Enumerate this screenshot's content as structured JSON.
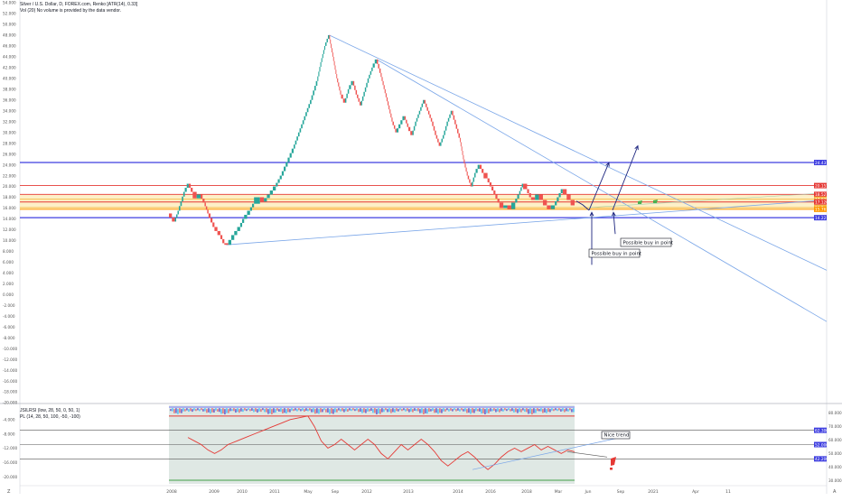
{
  "header": {
    "title": "Silver / U.S. Dollar, D, FOREX.com, Renko [ATR(14), 0.33]",
    "subtitle": "Vol (20) No volume is provided by the data vendor.",
    "osc_legend_1": "JSILRSI (low, 28, 50, 0, 50, 1)",
    "osc_legend_2": "PL (14, 28, 50, 100, -50, -100)"
  },
  "annotations": {
    "buy_1": "Possible buy in point",
    "buy_2": "Possible buy in point",
    "nice_trend": "Nice trend"
  },
  "colors": {
    "up": "#26a69a",
    "down": "#ef5350",
    "trendline": "#7aa6e8",
    "support_blue": "#3f3fe0",
    "resistance_red": "#e53935",
    "zone_fill": "#fdf0c8",
    "osc_bg": "#dfe8e4",
    "osc_line": "#e53935"
  },
  "price_labels": [
    {
      "text": "24.43",
      "color": "#3f3fe0"
    },
    {
      "text": "20.157",
      "color": "#e53935"
    },
    {
      "text": "18.527",
      "color": "#e53935"
    },
    {
      "text": "17.632",
      "color": "#f5b942"
    },
    {
      "text": "17.126",
      "color": "#e53935"
    },
    {
      "text": "16.1",
      "color": "#f5b942"
    },
    {
      "text": "15.767",
      "color": "#ff9800"
    },
    {
      "text": "14.22",
      "color": "#3f3fe0"
    }
  ],
  "osc_right_labels": [
    {
      "text": "62.300",
      "color": "#3f3fe0"
    },
    {
      "text": "52.000",
      "color": "#3f3fe0"
    },
    {
      "text": "42.200",
      "color": "#3f3fe0"
    }
  ],
  "chart_data": [
    {
      "type": "line",
      "title": "Silver / U.S. Dollar, D, FOREX.com, Renko [ATR(14), 0.33]",
      "x_ticks": [
        "2008",
        "2009",
        "2010",
        "2011",
        "May",
        "Sep",
        "2012",
        "2013",
        "2014",
        "2016",
        "2018",
        "Mar",
        "Jun",
        "Sep",
        "2021",
        "Apr",
        "11"
      ],
      "y_ticks": [
        "54.000",
        "52.000",
        "50.000",
        "48.000",
        "46.000",
        "44.000",
        "42.000",
        "40.000",
        "38.000",
        "36.000",
        "34.000",
        "32.000",
        "30.000",
        "28.000",
        "26.000",
        "24.000",
        "22.000",
        "20.000",
        "18.000",
        "16.000",
        "14.000",
        "12.000",
        "10.000",
        "8.000",
        "6.000",
        "4.000",
        "2.000",
        "0.000",
        "-2.000",
        "-4.000",
        "-6.000",
        "-8.000",
        "-10.000",
        "-12.000",
        "-14.000",
        "-16.000",
        "-18.000",
        "-20.000"
      ],
      "ylim": [
        -20,
        54
      ],
      "series": [
        {
          "name": "Silver / U.S. Dollar",
          "points": [
            [
              0,
              15
            ],
            [
              3,
              13.5
            ],
            [
              5,
              15.5
            ],
            [
              8,
              19
            ],
            [
              10,
              20.5
            ],
            [
              12,
              19
            ],
            [
              14,
              17.8
            ],
            [
              16,
              18.5
            ],
            [
              18,
              17
            ],
            [
              20,
              15
            ],
            [
              23,
              12.5
            ],
            [
              26,
              11
            ],
            [
              28,
              9.5
            ],
            [
              30,
              9.2
            ],
            [
              33,
              11
            ],
            [
              36,
              12.5
            ],
            [
              38,
              14
            ],
            [
              41,
              15.5
            ],
            [
              43,
              16.8
            ],
            [
              46,
              18
            ],
            [
              48,
              17.2
            ],
            [
              51,
              18.5
            ],
            [
              54,
              20
            ],
            [
              57,
              22
            ],
            [
              60,
              24.5
            ],
            [
              63,
              27
            ],
            [
              66,
              30
            ],
            [
              69,
              33
            ],
            [
              72,
              36
            ],
            [
              75,
              39.5
            ],
            [
              77,
              43
            ],
            [
              79,
              46
            ],
            [
              81,
              48
            ],
            [
              83,
              44
            ],
            [
              85,
              40
            ],
            [
              87,
              37
            ],
            [
              89,
              35.5
            ],
            [
              91,
              38
            ],
            [
              93,
              39.5
            ],
            [
              95,
              37
            ],
            [
              97,
              35
            ],
            [
              99,
              37.5
            ],
            [
              101,
              40
            ],
            [
              103,
              42
            ],
            [
              105,
              43.5
            ],
            [
              107,
              41
            ],
            [
              109,
              38
            ],
            [
              111,
              35
            ],
            [
              113,
              32
            ],
            [
              115,
              30
            ],
            [
              117,
              31.5
            ],
            [
              119,
              33
            ],
            [
              121,
              31
            ],
            [
              123,
              29.5
            ],
            [
              125,
              32
            ],
            [
              127,
              34
            ],
            [
              129,
              36
            ],
            [
              131,
              34
            ],
            [
              133,
              32
            ],
            [
              135,
              29.5
            ],
            [
              137,
              27.5
            ],
            [
              139,
              29.5
            ],
            [
              141,
              32
            ],
            [
              143,
              34
            ],
            [
              145,
              31.5
            ],
            [
              147,
              29
            ],
            [
              149,
              25
            ],
            [
              151,
              22
            ],
            [
              153,
              20
            ],
            [
              155,
              22.5
            ],
            [
              157,
              24
            ],
            [
              159,
              22.5
            ],
            [
              161,
              21.5
            ],
            [
              163,
              20
            ],
            [
              165,
              18.5
            ],
            [
              167,
              17
            ],
            [
              169,
              16
            ],
            [
              171,
              16.5
            ],
            [
              173,
              15.8
            ],
            [
              175,
              17
            ],
            [
              177,
              18.5
            ],
            [
              179,
              20.5
            ],
            [
              181,
              19.5
            ],
            [
              183,
              18
            ],
            [
              185,
              17.5
            ],
            [
              187,
              18.5
            ],
            [
              189,
              17.5
            ],
            [
              191,
              16.5
            ],
            [
              193,
              15.8
            ],
            [
              195,
              16.5
            ],
            [
              197,
              18
            ],
            [
              199,
              19.5
            ],
            [
              201,
              18.5
            ],
            [
              203,
              17.5
            ],
            [
              205,
              16.5
            ]
          ]
        }
      ],
      "trendlines": [
        "2008 low to 2020 projection",
        "2011 high to late 2021",
        "Sep 2011 high to late 2021"
      ],
      "projection": [
        "2020 down to support",
        "up toward 24.43",
        "up to 27.5"
      ]
    },
    {
      "type": "line",
      "title": "PL (14, 28, 50, 100, -50, -100)",
      "y_ticks": [
        "-4.000",
        "-8.000",
        "-12.000",
        "-16.000",
        "-20.000"
      ],
      "right_ticks": [
        "80.000",
        "70.000",
        "60.000",
        "50.000",
        "40.000",
        "30.000"
      ],
      "ylim": [
        -22,
        0
      ],
      "series": [
        {
          "name": "PL",
          "points": [
            [
              0,
              -9
            ],
            [
              3,
              -10
            ],
            [
              6,
              -11
            ],
            [
              9,
              -12.5
            ],
            [
              12,
              -13.5
            ],
            [
              15,
              -12.5
            ],
            [
              18,
              -11
            ],
            [
              22,
              -10
            ],
            [
              26,
              -9
            ],
            [
              30,
              -8
            ],
            [
              34,
              -7
            ],
            [
              38,
              -6
            ],
            [
              42,
              -5
            ],
            [
              46,
              -4
            ],
            [
              50,
              -3.5
            ],
            [
              54,
              -3
            ],
            [
              57,
              -6
            ],
            [
              60,
              -10
            ],
            [
              63,
              -12
            ],
            [
              66,
              -11
            ],
            [
              69,
              -9.5
            ],
            [
              72,
              -11
            ],
            [
              75,
              -12.5
            ],
            [
              78,
              -11
            ],
            [
              81,
              -9.5
            ],
            [
              84,
              -11
            ],
            [
              87,
              -13.5
            ],
            [
              90,
              -15
            ],
            [
              93,
              -13
            ],
            [
              96,
              -11
            ],
            [
              99,
              -12.5
            ],
            [
              102,
              -11
            ],
            [
              105,
              -9.5
            ],
            [
              108,
              -11
            ],
            [
              111,
              -13
            ],
            [
              114,
              -15.5
            ],
            [
              117,
              -17
            ],
            [
              120,
              -15.5
            ],
            [
              123,
              -14
            ],
            [
              126,
              -13
            ],
            [
              129,
              -14.5
            ],
            [
              132,
              -16.5
            ],
            [
              135,
              -18
            ],
            [
              138,
              -16.5
            ],
            [
              141,
              -14.5
            ],
            [
              144,
              -13
            ],
            [
              147,
              -12
            ],
            [
              150,
              -13
            ],
            [
              153,
              -12
            ],
            [
              156,
              -11
            ],
            [
              159,
              -12.5
            ],
            [
              162,
              -11.5
            ],
            [
              165,
              -12.5
            ],
            [
              168,
              -13.5
            ],
            [
              171,
              -12.5
            ],
            [
              174,
              -13
            ]
          ]
        }
      ]
    }
  ]
}
